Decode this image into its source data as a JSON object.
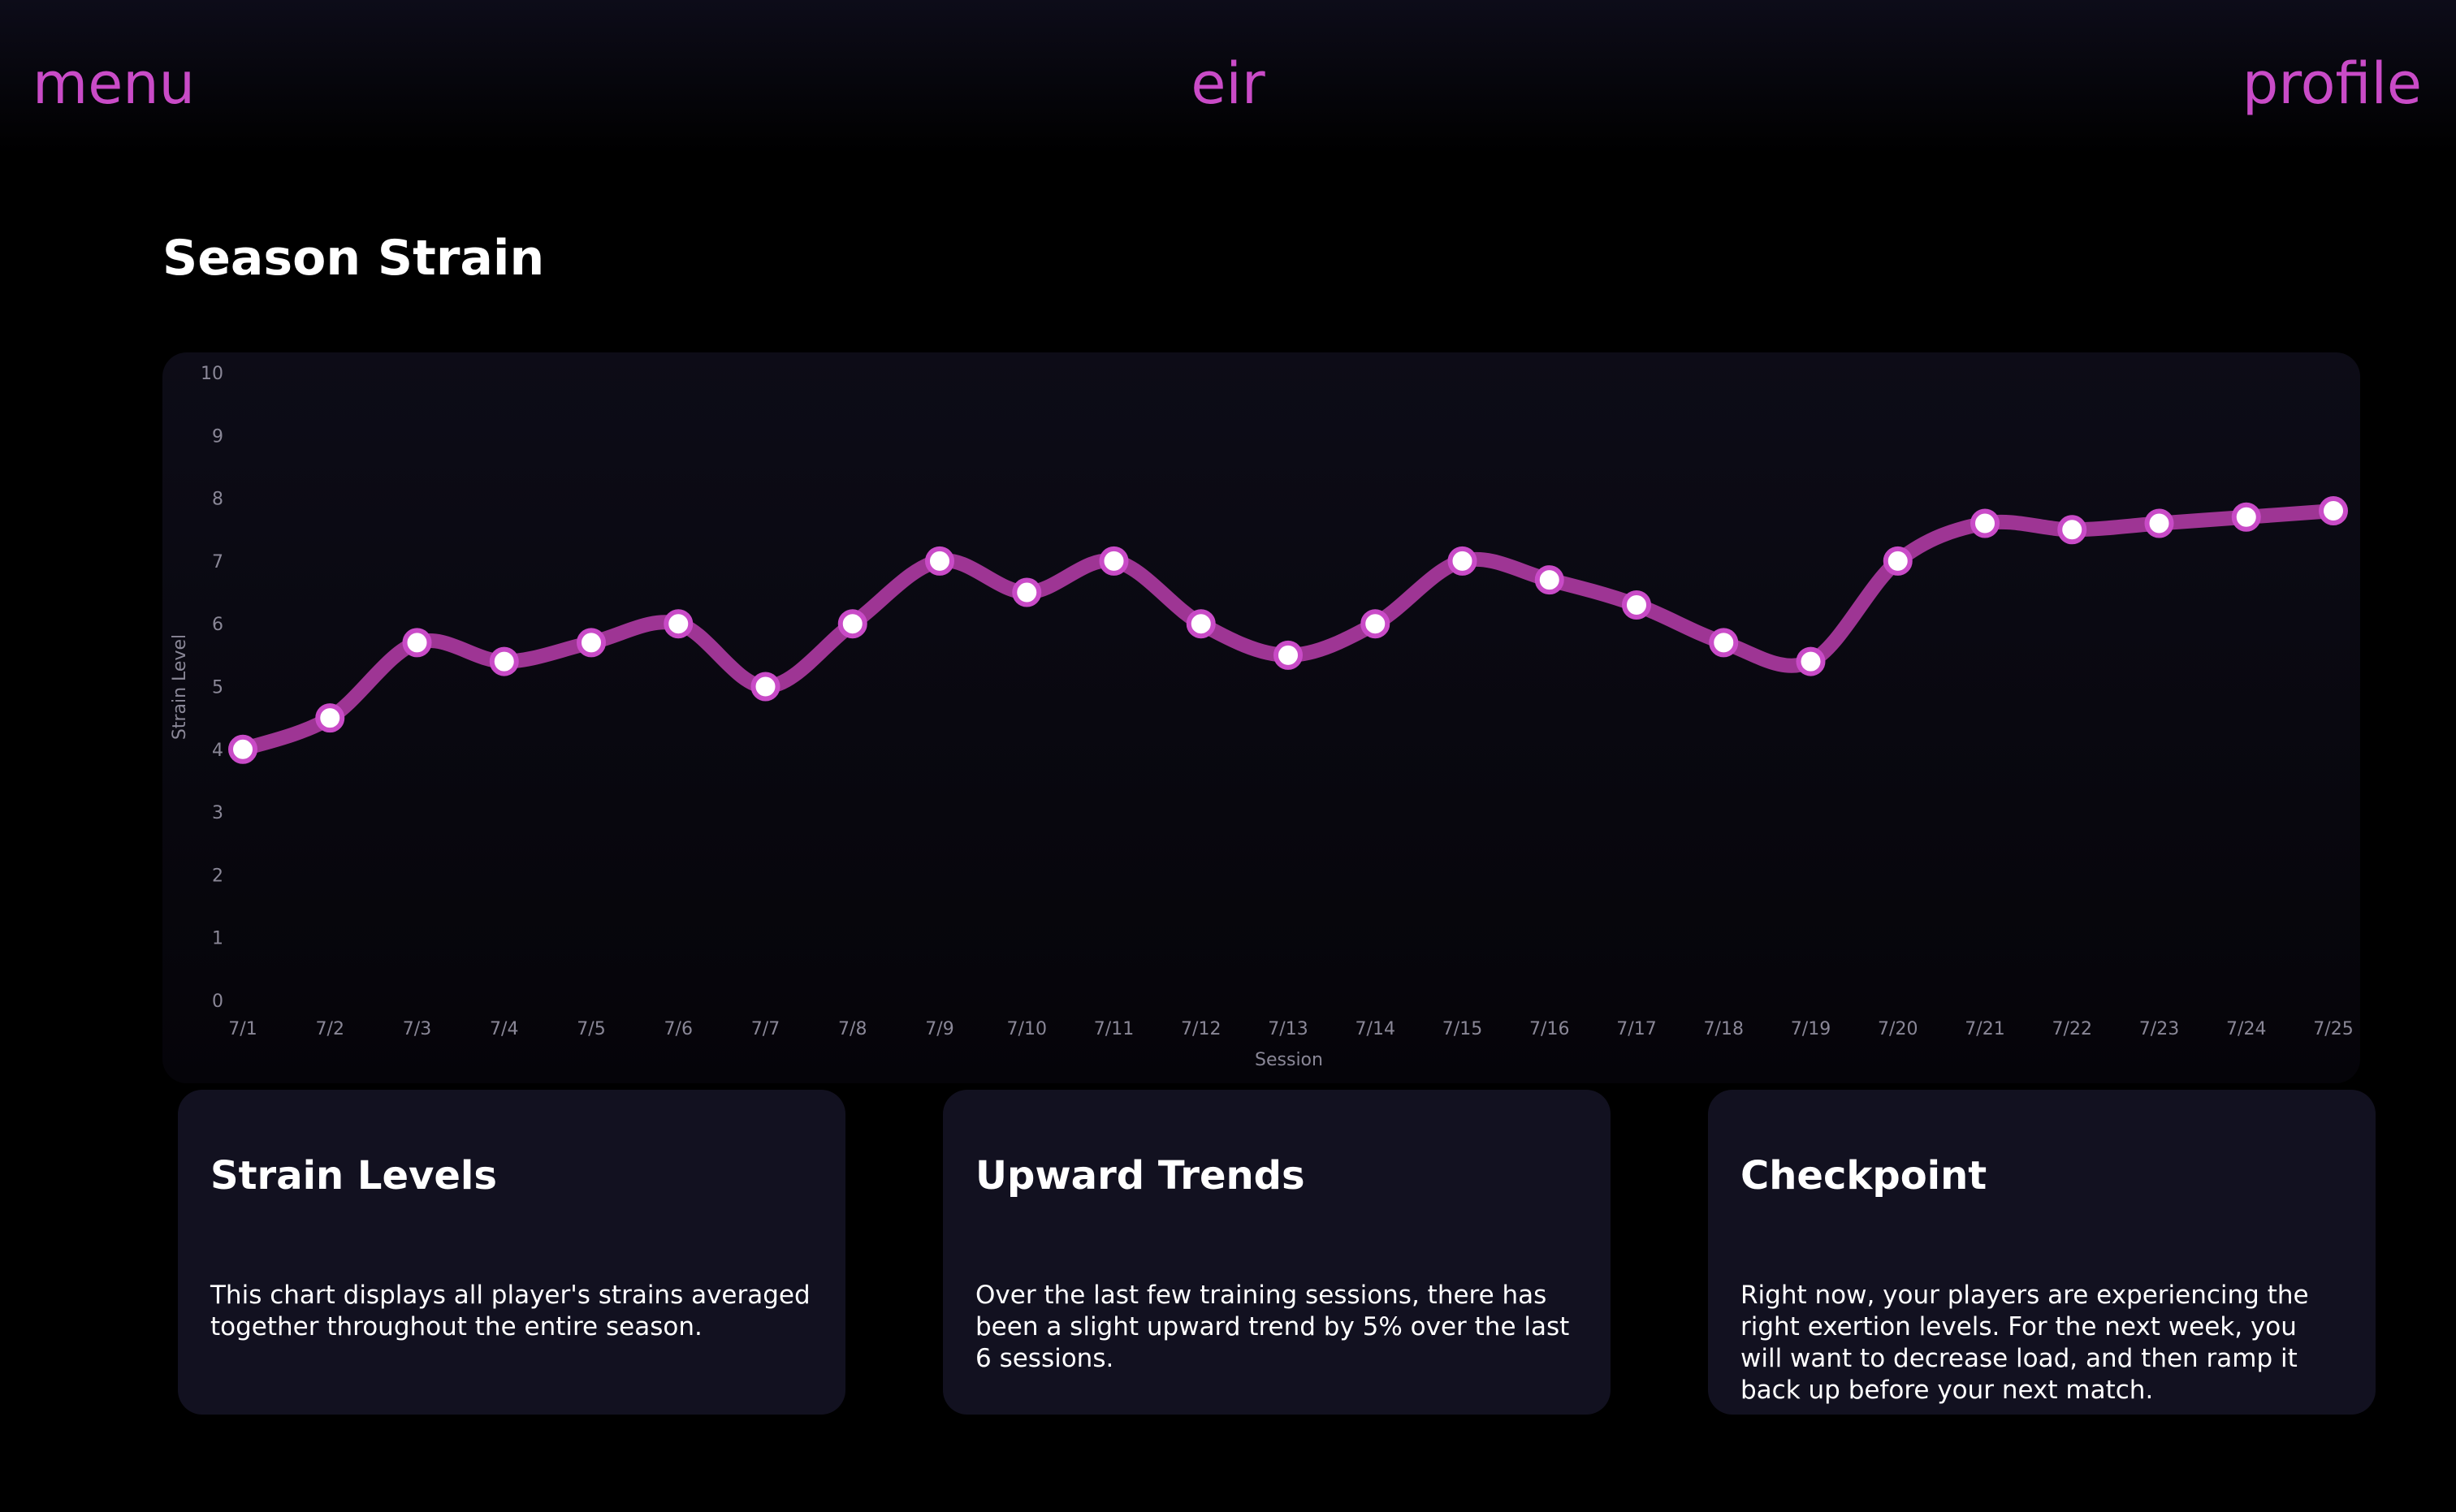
{
  "nav": {
    "menu": "menu",
    "brand": "eir",
    "profile": "profile"
  },
  "page": {
    "title": "Season Strain"
  },
  "colors": {
    "accent": "#c94bc7",
    "line": "#9e3594",
    "card_bg": "#121120"
  },
  "chart_data": {
    "type": "line",
    "title": "",
    "xlabel": "Session",
    "ylabel": "Strain Level",
    "categories": [
      "7/1",
      "7/2",
      "7/3",
      "7/4",
      "7/5",
      "7/6",
      "7/7",
      "7/8",
      "7/9",
      "7/10",
      "7/11",
      "7/12",
      "7/13",
      "7/14",
      "7/15",
      "7/16",
      "7/17",
      "7/18",
      "7/19",
      "7/20",
      "7/21",
      "7/22",
      "7/23",
      "7/24",
      "7/25"
    ],
    "values": [
      4,
      4.5,
      5.7,
      5.4,
      5.7,
      6,
      5,
      6,
      7,
      6.5,
      7,
      6,
      5.5,
      6,
      7,
      6.7,
      6.3,
      5.7,
      5.4,
      7,
      7.6,
      7.5,
      7.6,
      7.7,
      7.8
    ],
    "yticks": [
      0,
      1,
      2,
      3,
      4,
      5,
      6,
      7,
      8,
      9,
      10
    ],
    "ylim": [
      0,
      10
    ],
    "grid": false,
    "legend": "none"
  },
  "cards": [
    {
      "title": "Strain Levels",
      "body": "This chart displays all player's strains averaged together throughout the entire season."
    },
    {
      "title": "Upward Trends",
      "body": "Over the last few training sessions, there has been a slight upward trend by 5% over the last 6 sessions."
    },
    {
      "title": "Checkpoint",
      "body": "Right now, your players are experiencing the right exertion levels. For the next week, you will want to decrease load, and then ramp it back up before your next match."
    }
  ]
}
